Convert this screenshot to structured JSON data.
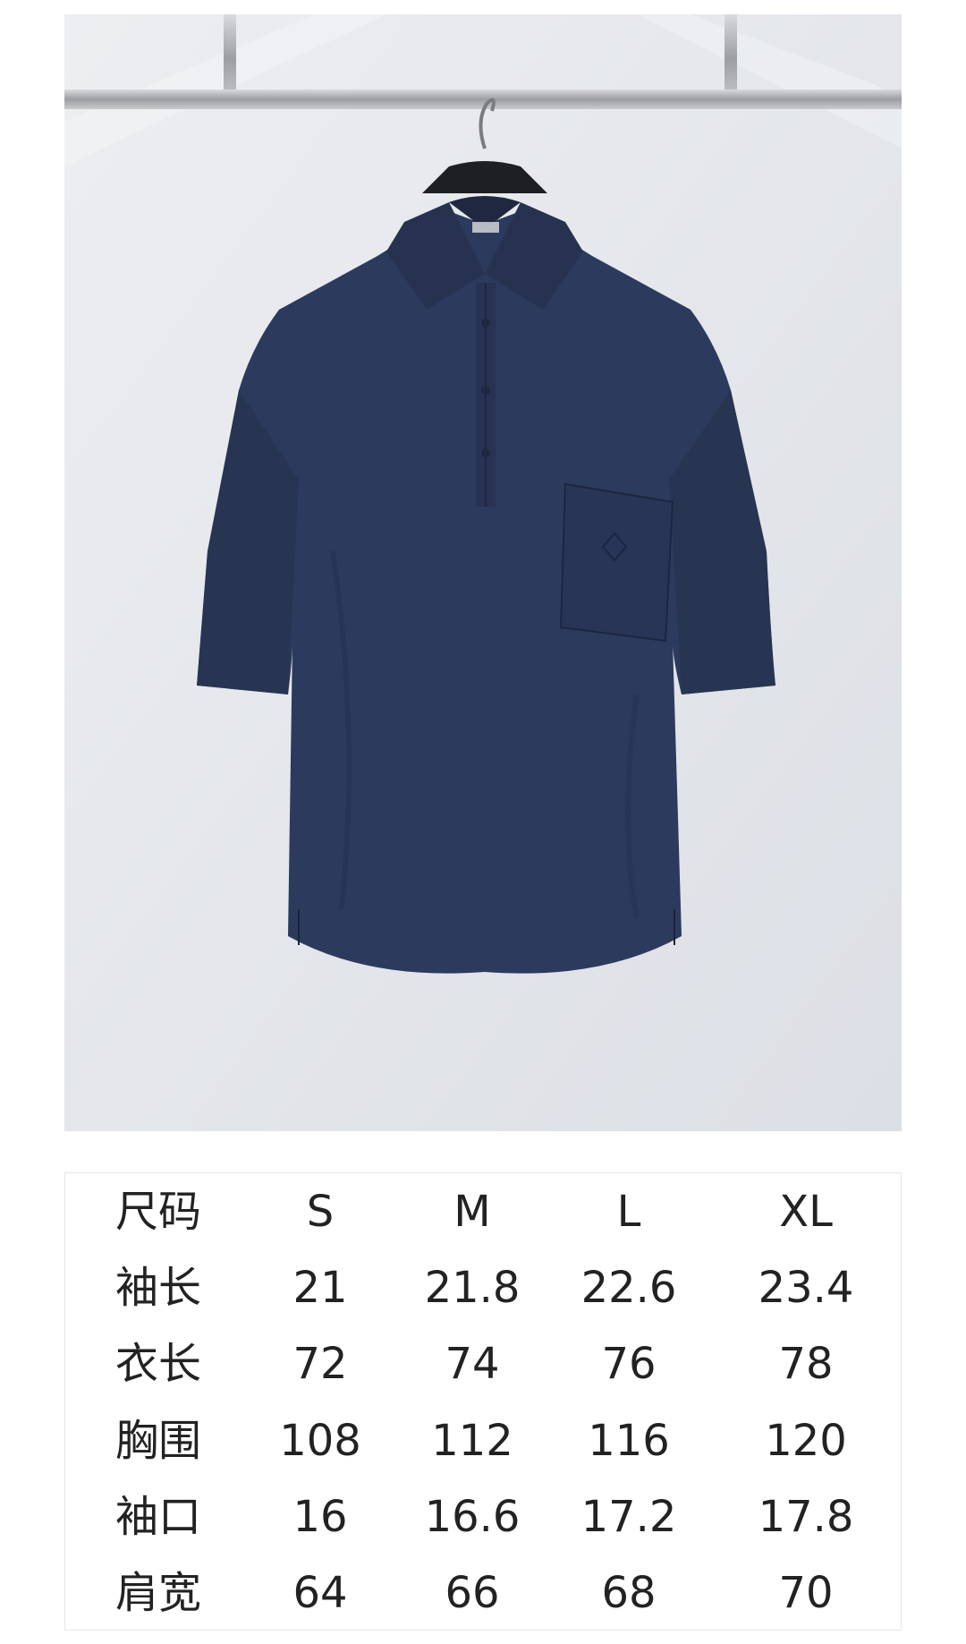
{
  "product": {
    "photo_alt": "navy short-sleeve polo shirt on a hanger",
    "colors": {
      "shirt": "#2c3a5e",
      "shirt_shadow": "#222d4a",
      "background": "#e4e6eb",
      "rail": "#b7b9bd"
    }
  },
  "size_table": {
    "header": [
      "尺码",
      "S",
      "M",
      "L",
      "XL"
    ],
    "rows": [
      [
        "袖长",
        "21",
        "21.8",
        "22.6",
        "23.4"
      ],
      [
        "衣长",
        "72",
        "74",
        "76",
        "78"
      ],
      [
        "胸围",
        "108",
        "112",
        "116",
        "120"
      ],
      [
        "袖口",
        "16",
        "16.6",
        "17.2",
        "17.8"
      ],
      [
        "肩宽",
        "64",
        "66",
        "68",
        "70"
      ]
    ]
  }
}
